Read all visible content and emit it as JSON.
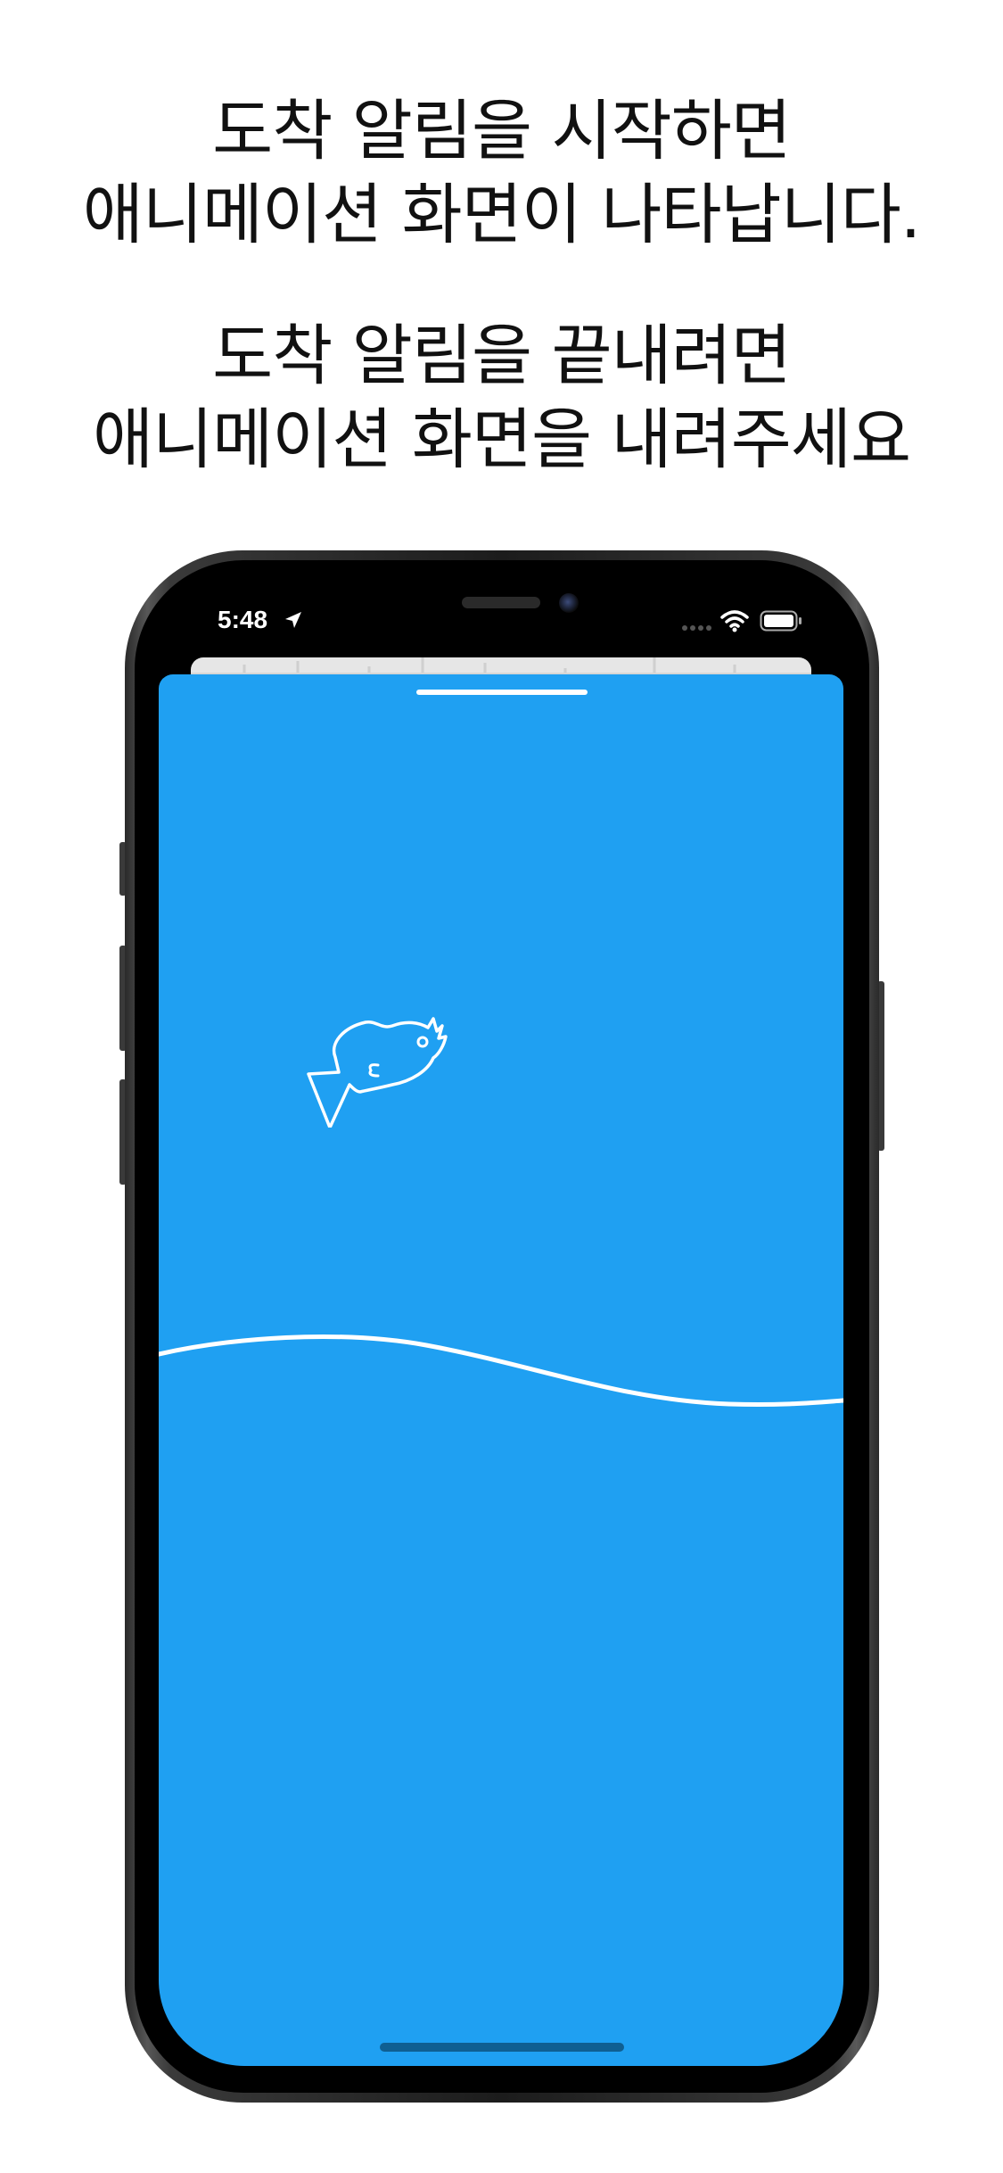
{
  "caption": {
    "block1": {
      "line1": "도착 알림을 시작하면",
      "line2": "애니메이션 화면이 나타납니다."
    },
    "block2": {
      "line1": "도착 알림을 끝내려면",
      "line2": "애니메이션 화면을 내려주세요"
    }
  },
  "status_bar": {
    "time": "5:48",
    "icons": [
      "location-arrow-icon",
      "signal-icon",
      "wifi-icon",
      "battery-icon"
    ]
  },
  "sheet": {
    "background_color": "#1fa0f2",
    "illustration": "fish-icon",
    "decoration": "wave-line"
  },
  "colors": {
    "sheet_blue": "#1fa0f2",
    "text": "#111111",
    "frame": "#000000"
  }
}
